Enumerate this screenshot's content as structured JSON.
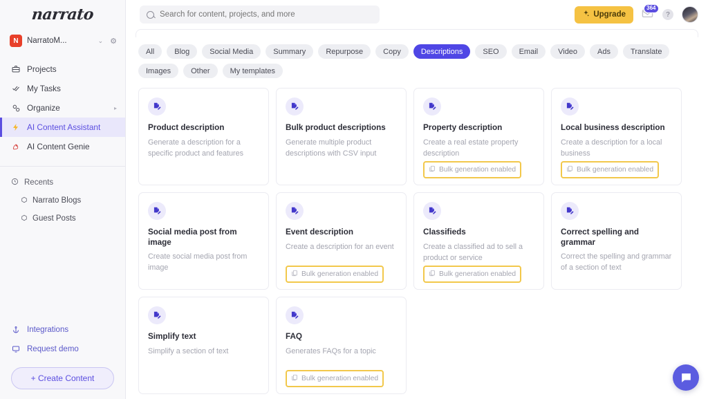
{
  "sidebar": {
    "brand": "narrato",
    "workspace": {
      "initial": "N",
      "name": "NarratoM...",
      "caret": "⌄",
      "gear": "⚙"
    },
    "nav": [
      {
        "label": "Projects",
        "icon": "briefcase-icon",
        "glyph": "🗂",
        "active": false,
        "chevron": ""
      },
      {
        "label": "My Tasks",
        "icon": "check-icon",
        "glyph": "✓",
        "active": false,
        "chevron": ""
      },
      {
        "label": "Organize",
        "icon": "organize-icon",
        "glyph": "⚙",
        "active": false,
        "chevron": "▸"
      },
      {
        "label": "AI Content Assistant",
        "icon": "lightning-icon",
        "glyph": "⚡",
        "active": true,
        "chevron": ""
      },
      {
        "label": "AI Content Genie",
        "icon": "rocket-icon",
        "glyph": "🚀",
        "active": false,
        "chevron": ""
      }
    ],
    "recents_label": "Recents",
    "recents_icon": "clock-icon",
    "recents": [
      {
        "label": "Narrato Blogs",
        "icon": "box-icon",
        "glyph": "⬡"
      },
      {
        "label": "Guest Posts",
        "icon": "box-icon",
        "glyph": "⬡"
      }
    ],
    "bottom": [
      {
        "label": "Integrations",
        "icon": "anchor-icon",
        "glyph": "⚓"
      },
      {
        "label": "Request demo",
        "icon": "monitor-icon",
        "glyph": "🖵"
      }
    ],
    "create_button": "+ Create Content"
  },
  "topbar": {
    "search_placeholder": "Search for content, projects, and more",
    "search_value": "",
    "upgrade_label": "Upgrade",
    "upgrade_icon": "sparkle-icon",
    "notification_count": "364",
    "help_label": "?",
    "avatar_name": "user-avatar"
  },
  "tabs": [
    {
      "label": "All",
      "active": false
    },
    {
      "label": "Blog",
      "active": false
    },
    {
      "label": "Social Media",
      "active": false
    },
    {
      "label": "Summary",
      "active": false
    },
    {
      "label": "Repurpose",
      "active": false
    },
    {
      "label": "Copy",
      "active": false
    },
    {
      "label": "Descriptions",
      "active": true
    },
    {
      "label": "SEO",
      "active": false
    },
    {
      "label": "Email",
      "active": false
    },
    {
      "label": "Video",
      "active": false
    },
    {
      "label": "Ads",
      "active": false
    },
    {
      "label": "Translate",
      "active": false
    },
    {
      "label": "Images",
      "active": false
    },
    {
      "label": "Other",
      "active": false
    },
    {
      "label": "My templates",
      "active": false
    }
  ],
  "bulk_badge_label": "Bulk generation enabled",
  "cards": [
    {
      "title": "Product description",
      "desc": "Generate a description for a specific product and features",
      "bulk": false
    },
    {
      "title": "Bulk product descriptions",
      "desc": "Generate multiple product descriptions with CSV input",
      "bulk": false
    },
    {
      "title": "Property description",
      "desc": "Create a real estate property description",
      "bulk": true
    },
    {
      "title": "Local business description",
      "desc": "Create a description for a local business",
      "bulk": true
    },
    {
      "title": "Social media post from image",
      "desc": "Create social media post from image",
      "bulk": false
    },
    {
      "title": "Event description",
      "desc": "Create a description for an event",
      "bulk": true
    },
    {
      "title": "Classifieds",
      "desc": "Create a classified ad to sell a product or service",
      "bulk": true
    },
    {
      "title": "Correct spelling and grammar",
      "desc": "Correct the spelling and grammar of a section of text",
      "bulk": false
    },
    {
      "title": "Simplify text",
      "desc": "Simplify a section of text",
      "bulk": false
    },
    {
      "title": "FAQ",
      "desc": "Generates FAQs for a topic",
      "bulk": true
    }
  ],
  "chat": {
    "icon": "chat-bubble-icon"
  },
  "colors": {
    "accent": "#5b4ee0",
    "tab_active": "#4f46e5",
    "upgrade": "#f5c243",
    "bulk_border": "#f2c84b",
    "workspace_avatar": "#e8402a"
  }
}
